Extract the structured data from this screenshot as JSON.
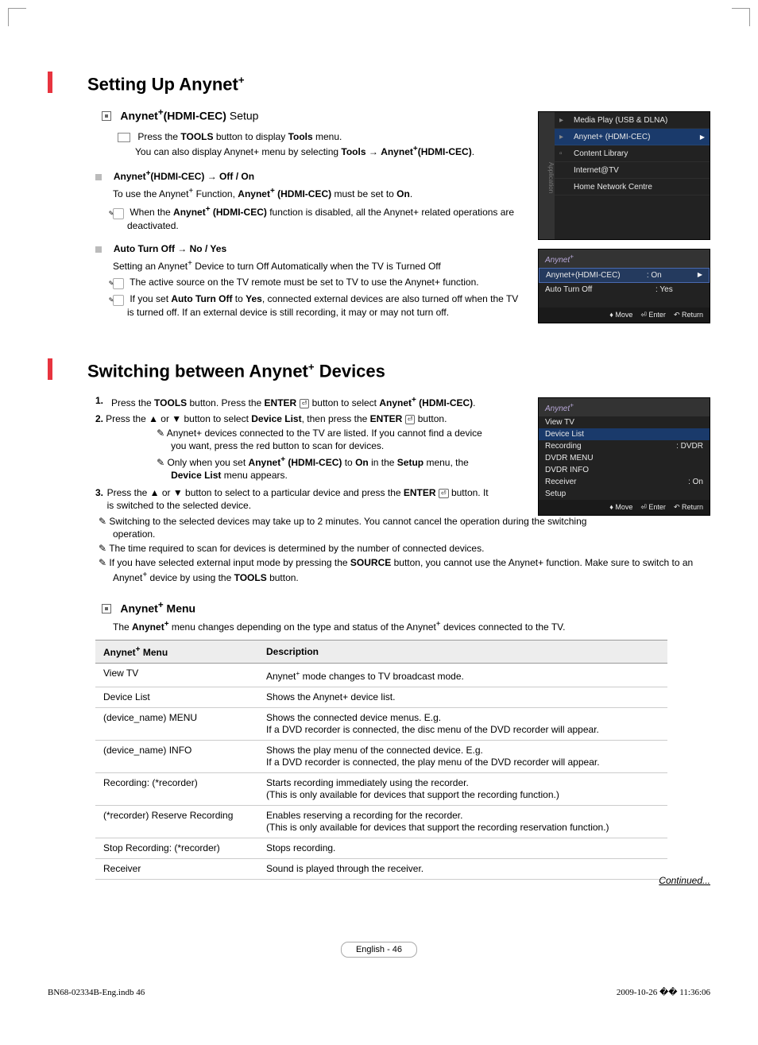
{
  "headings": {
    "h1a": "Setting Up Anynet",
    "h1a_sup": "+",
    "h1b": "Switching between Anynet",
    "h1b_sup": "+",
    "h1b_tail": " Devices",
    "sub1_a": "Anynet",
    "sub1_b": "(HDMI-CEC)",
    "sub1_c": " Setup",
    "menu_sub_a": "Anynet",
    "menu_sub_b": " Menu"
  },
  "intro": {
    "line1a": "Press the ",
    "line1b": "TOOLS",
    "line1c": " button to display ",
    "line1d": "Tools",
    "line1e": " menu.",
    "line2a": "You can also display Anynet+ menu by selecting ",
    "line2b": "Tools",
    "line2c": " → ",
    "line2d": "Anynet",
    "line2e": "(HDMI-CEC)",
    "line2f": "."
  },
  "sec_a": {
    "title_a": "Anynet",
    "title_b": "(HDMI-CEC) → Off / On",
    "line1a": "To use the Anynet",
    "line1b": " Function, ",
    "line1c": "Anynet",
    "line1d": " (HDMI-CEC)",
    "line1e": " must be set to ",
    "line1f": "On",
    "line1g": ".",
    "note1a": "When the ",
    "note1b": "Anynet",
    "note1c": " (HDMI-CEC)",
    "note1d": " function is disabled, all the Anynet+ related operations are deactivated."
  },
  "sec_b": {
    "title": "Auto Turn Off → No / Yes",
    "line1": "Setting an Anynet",
    "line1b": " Device to turn Off Automatically when the TV is Turned Off",
    "note1": "The active source on the TV remote must be set to TV to use the Anynet+ function.",
    "note2a": "If you set ",
    "note2b": "Auto Turn Off",
    "note2c": " to ",
    "note2d": "Yes",
    "note2e": ", connected external devices are also turned off when the TV is turned off. If an external device is still recording, it may or may not turn off."
  },
  "osd1": {
    "side": "Application",
    "r1": "Media Play (USB & DLNA)",
    "r2": "Anynet+ (HDMI-CEC)",
    "r3": "Content Library",
    "r4": "Internet@TV",
    "r5": "Home Network Centre"
  },
  "osd2": {
    "brand": "Anynet",
    "brand_sup": "+",
    "k1": "Anynet+(HDMI-CEC)",
    "v1": ": On",
    "k2": "Auto Turn Off",
    "v2": ": Yes",
    "f1": "Move",
    "f2": "Enter",
    "f3": "Return"
  },
  "osd3": {
    "brand": "Anynet",
    "brand_sup": "+",
    "r1": "View TV",
    "r2": "Device List",
    "r3": "Recording",
    "r3v": ": DVDR",
    "r4": "DVDR MENU",
    "r5": "DVDR INFO",
    "r6": "Receiver",
    "r6v": ": On",
    "r7": "Setup",
    "f1": "Move",
    "f2": "Enter",
    "f3": "Return"
  },
  "steps": {
    "s1a": "Press the ",
    "s1b": "TOOLS",
    "s1c": " button. Press the ",
    "s1d": "ENTER",
    "s1e": " button to select ",
    "s1f": "Anynet",
    "s1g": " (HDMI-CEC)",
    "s1h": ".",
    "s2a": "Press the ▲ or ▼ button to select ",
    "s2b": "Device List",
    "s2c": ", then press the ",
    "s2d": "ENTER",
    "s2e": " button.",
    "s2n1": "Anynet+ devices connected to the TV are listed. If you cannot find a device you want, press the red button to scan for devices.",
    "s2n2a": "Only when you set ",
    "s2n2b": "Anynet",
    "s2n2c": " (HDMI-CEC)",
    "s2n2d": " to ",
    "s2n2e": "On",
    "s2n2f": " in the ",
    "s2n2g": "Setup",
    "s2n2h": " menu, the ",
    "s2n2i": "Device List",
    "s2n2j": " menu appears.",
    "s3a": "Press the ▲ or ▼ button to select to a particular device and press the ",
    "s3b": "ENTER",
    "s3c": " button. It is switched to the selected device.",
    "pn1": "Switching to the selected devices may take up to 2 minutes. You cannot cancel the operation during the switching operation.",
    "pn2": "The time required to scan for devices is determined by the number of connected devices.",
    "pn3a": "If you have selected external input mode by pressing the ",
    "pn3b": "SOURCE",
    "pn3c": " button, you cannot use the Anynet+ function. Make sure to switch to an Anynet",
    "pn3d": " device by using the ",
    "pn3e": "TOOLS",
    "pn3f": " button."
  },
  "menu_intro_a": "The ",
  "menu_intro_b": "Anynet",
  "menu_intro_c": " menu changes depending on the type and status of the Anynet",
  "menu_intro_d": " devices connected to the TV.",
  "table": {
    "h1": "Anynet",
    "h1b": " Menu",
    "h2": "Description",
    "rows": [
      {
        "a": "View TV",
        "b_pre": "Anynet",
        "b": " mode changes to TV broadcast mode."
      },
      {
        "a": "Device List",
        "b": "Shows the Anynet+ device list."
      },
      {
        "a": "(device_name) MENU",
        "b": "Shows the connected device menus. E.g.\nIf a DVD recorder is connected, the disc menu of the DVD recorder will appear."
      },
      {
        "a": "(device_name) INFO",
        "b": "Shows the play menu of the connected device. E.g.\nIf a DVD recorder is connected, the play menu of the DVD recorder will appear."
      },
      {
        "a": "Recording: (*recorder)",
        "b": "Starts recording immediately using the recorder.\n(This is only available for devices that support the recording function.)"
      },
      {
        "a": "(*recorder) Reserve Recording",
        "b": "Enables reserving a recording for the recorder.\n(This is only available for devices that support the recording reservation function.)"
      },
      {
        "a": "Stop Recording: (*recorder)",
        "b": "Stops recording."
      },
      {
        "a": "Receiver",
        "b": "Sound is played through the receiver."
      }
    ]
  },
  "continued": "Continued...",
  "pagenum": "English - 46",
  "foot_l": "BN68-02334B-Eng.indb   46",
  "foot_r": "2009-10-26   �� 11:36:06"
}
